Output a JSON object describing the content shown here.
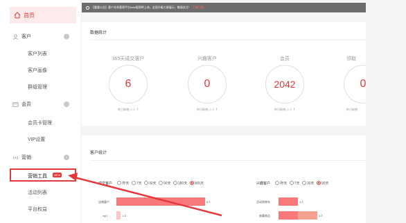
{
  "sidebar": {
    "home": "首页",
    "customers": {
      "label": "客户",
      "items": [
        "客户列表",
        "客户画像",
        "群组管理"
      ]
    },
    "members": {
      "label": "会员",
      "items": [
        "会员卡管理",
        "VIP设置"
      ]
    },
    "marketing": {
      "label": "营销",
      "active_item": "营销工具",
      "badge": "NEW",
      "items": [
        "活动列表",
        "平台权益"
      ]
    }
  },
  "notice": {
    "text": "【重要公告】客户关系管理平台beta版即将上线，全面升级大屏展示，敬请关注！",
    "link": "了解详情"
  },
  "stats_panel": {
    "title": "数据统计",
    "stats": [
      {
        "label": "365天成交客户",
        "value": "6",
        "yesterday": "昨日新增: 0 人"
      },
      {
        "label": "兴趣客户",
        "value": "0",
        "yesterday": "昨日新增: 0 人"
      },
      {
        "label": "会员",
        "value": "2042",
        "yesterday": "昨日新增: 0 人"
      },
      {
        "label": "领取",
        "value": "0",
        "yesterday": "昨日新增"
      }
    ]
  },
  "customer_panel": {
    "title": "客户统计",
    "left_group": {
      "label": "成交客户",
      "options": [
        "昨天",
        "7天",
        "30天",
        "90天",
        "180天",
        "365天"
      ],
      "selected": "365天"
    },
    "right_group": {
      "label": "兴趣客户",
      "options": [
        "昨天",
        "7天",
        "30天",
        "90天"
      ],
      "selected": "90天"
    },
    "left_bars": [
      {
        "label": "店铺客户",
        "value": "5人"
      },
      {
        "label": "vip1",
        "value": "1人"
      }
    ],
    "right_bars": [
      {
        "label": "活动购物车",
        "value": "1人"
      },
      {
        "label": "收藏商品",
        "value": "2人"
      }
    ]
  },
  "chart_data": [
    {
      "type": "bar",
      "title": "",
      "categories": [
        "店铺客户",
        "vip1"
      ],
      "values": [
        5,
        1
      ]
    },
    {
      "type": "bar",
      "title": "",
      "categories": [
        "活动购物车",
        "收藏商品"
      ],
      "values": [
        1,
        2
      ]
    }
  ],
  "colors": {
    "accent": "#e4393c",
    "bar": "#f87979"
  }
}
